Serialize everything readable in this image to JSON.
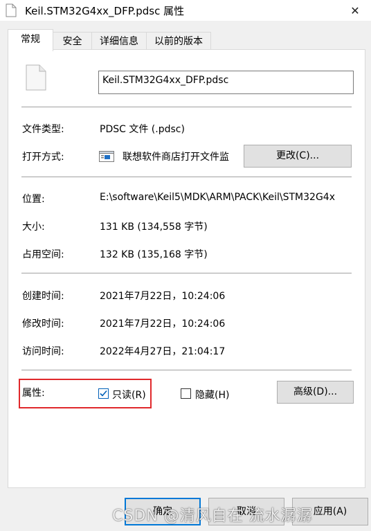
{
  "window": {
    "title": "Keil.STM32G4xx_DFP.pdsc 属性",
    "close_glyph": "✕"
  },
  "tabs": [
    {
      "label": "常规",
      "active": true
    },
    {
      "label": "安全",
      "active": false
    },
    {
      "label": "详细信息",
      "active": false
    },
    {
      "label": "以前的版本",
      "active": false
    }
  ],
  "general": {
    "file_name": "Keil.STM32G4xx_DFP.pdsc",
    "file_type": {
      "label": "文件类型:",
      "value": "PDSC 文件 (.pdsc)"
    },
    "opens_with": {
      "label": "打开方式:",
      "value": "联想软件商店打开文件监",
      "change_button": "更改(C)..."
    },
    "location": {
      "label": "位置:",
      "value": "E:\\software\\Keil5\\MDK\\ARM\\PACK\\Keil\\STM32G4x"
    },
    "size": {
      "label": "大小:",
      "value": "131 KB (134,558 字节)"
    },
    "size_on_disk": {
      "label": "占用空间:",
      "value": "132 KB (135,168 字节)"
    },
    "created": {
      "label": "创建时间:",
      "value": "2021年7月22日，10:24:06"
    },
    "modified": {
      "label": "修改时间:",
      "value": "2021年7月22日，10:24:06"
    },
    "accessed": {
      "label": "访问时间:",
      "value": "2022年4月27日，21:04:17"
    },
    "attributes": {
      "label": "属性:",
      "readonly": {
        "label": "只读(R)",
        "checked": true
      },
      "hidden": {
        "label": "隐藏(H)",
        "checked": false
      },
      "advanced_button": "高级(D)..."
    }
  },
  "footer": {
    "ok": "确定",
    "cancel": "取消",
    "apply": "应用(A)"
  },
  "watermark": "CSDN @清风自在 流水潺潺",
  "colors": {
    "accent": "#0078d7",
    "highlight_box": "#e0282b"
  }
}
